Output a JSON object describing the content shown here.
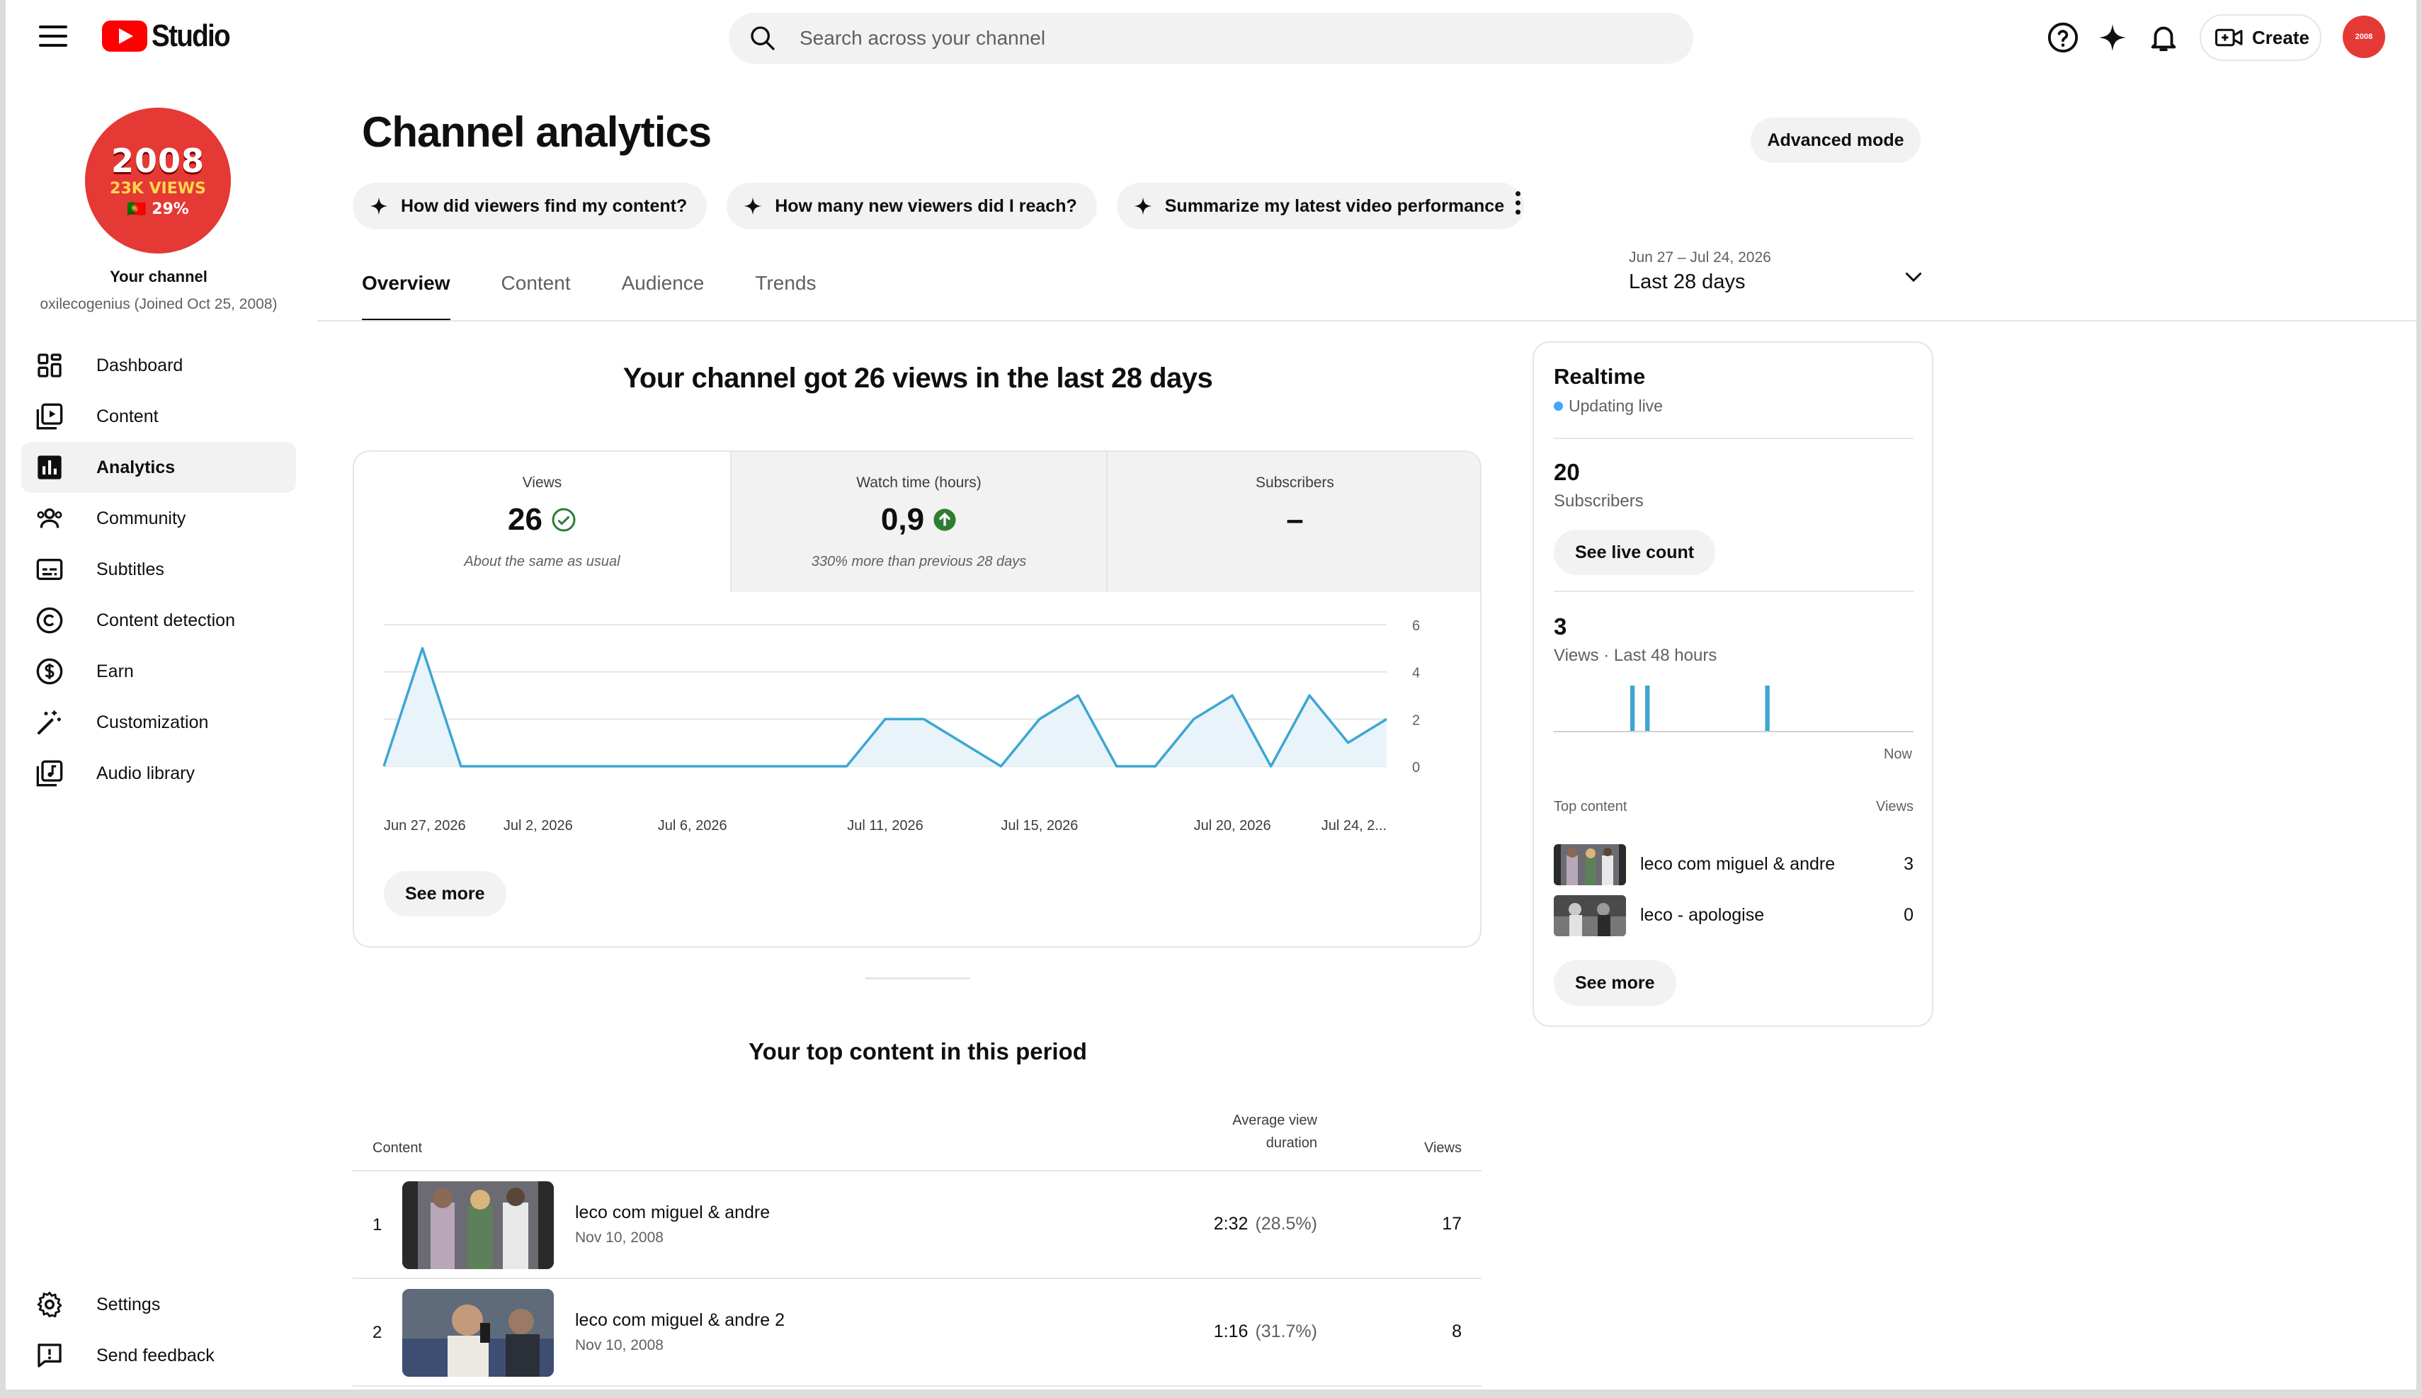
{
  "app": {
    "logo_text": "Studio",
    "brand_color": "#ff0000"
  },
  "search": {
    "placeholder": "Search across your channel"
  },
  "topbar": {
    "create_label": "Create",
    "avatar_text": "2008"
  },
  "channel": {
    "avatar_line1": "2008",
    "avatar_line2": "23K VIEWS",
    "avatar_line3": "🇵🇹 29%",
    "label": "Your channel",
    "handle": "oxilecogenius (Joined Oct 25, 2008)"
  },
  "sidebar": {
    "items": [
      {
        "label": "Dashboard",
        "icon": "dashboard-icon"
      },
      {
        "label": "Content",
        "icon": "content-icon"
      },
      {
        "label": "Analytics",
        "icon": "analytics-icon",
        "active": true
      },
      {
        "label": "Community",
        "icon": "community-icon"
      },
      {
        "label": "Subtitles",
        "icon": "subtitles-icon"
      },
      {
        "label": "Content detection",
        "icon": "copyright-icon"
      },
      {
        "label": "Earn",
        "icon": "dollar-icon"
      },
      {
        "label": "Customization",
        "icon": "magic-wand-icon"
      },
      {
        "label": "Audio library",
        "icon": "audio-library-icon"
      }
    ],
    "bottom": [
      {
        "label": "Settings",
        "icon": "gear-icon"
      },
      {
        "label": "Send feedback",
        "icon": "feedback-icon"
      }
    ]
  },
  "header": {
    "title": "Channel analytics",
    "advanced_mode": "Advanced mode",
    "chips": [
      "How did viewers find my content?",
      "How many new viewers did I reach?",
      "Summarize my latest video performance"
    ],
    "tabs": [
      "Overview",
      "Content",
      "Audience",
      "Trends"
    ],
    "date_range_sub": "Jun 27 – Jul 24, 2026",
    "date_range_main": "Last 28 days"
  },
  "overview": {
    "summary": "Your channel got 26 views in the last 28 days",
    "metrics": [
      {
        "label": "Views",
        "value": "26",
        "note": "About the same as usual"
      },
      {
        "label": "Watch time (hours)",
        "value": "0,9",
        "note": "330% more than previous 28 days"
      },
      {
        "label": "Subscribers",
        "value": "–",
        "note": ""
      }
    ],
    "see_more": "See more"
  },
  "chart_data": {
    "type": "area",
    "x_tick_labels": [
      "Jun 27, 2026",
      "Jul 2, 2026",
      "Jul 6, 2026",
      "Jul 11, 2026",
      "Jul 15, 2026",
      "Jul 20, 2026",
      "Jul 24, 2..."
    ],
    "x_tick_index": [
      0,
      4,
      8,
      13,
      17,
      22,
      26
    ],
    "values": [
      0,
      5,
      0,
      0,
      0,
      0,
      0,
      0,
      0,
      0,
      0,
      0,
      0,
      2,
      2,
      1,
      0,
      2,
      3,
      0,
      0,
      2,
      3,
      0,
      3,
      1,
      2
    ],
    "y_ticks": [
      0,
      2,
      4,
      6
    ],
    "ylim": [
      0,
      6
    ],
    "color": "#3ea6d2",
    "fill": "#e8f4fa",
    "grid": true
  },
  "top_content": {
    "title": "Your top content in this period",
    "col_content": "Content",
    "col_avd_line1": "Average view",
    "col_avd_line2": "duration",
    "col_views": "Views",
    "rows": [
      {
        "rank": "1",
        "title": "leco com miguel & andre",
        "date": "Nov 10, 2008",
        "avd": "2:32",
        "avd_pct": "(28.5%)",
        "views": "17"
      },
      {
        "rank": "2",
        "title": "leco com miguel & andre 2",
        "date": "Nov 10, 2008",
        "avd": "1:16",
        "avd_pct": "(31.7%)",
        "views": "8"
      }
    ]
  },
  "realtime": {
    "title": "Realtime",
    "live": "Updating live",
    "subscribers_value": "20",
    "subscribers_label": "Subscribers",
    "see_live_count": "See live count",
    "views_value": "3",
    "views_label": "Views · Last 48 hours",
    "bar_values": [
      0,
      0,
      0,
      0,
      0,
      0,
      0,
      0,
      0,
      0,
      1,
      0,
      1,
      0,
      0,
      0,
      0,
      0,
      0,
      0,
      0,
      0,
      0,
      0,
      0,
      0,
      0,
      0,
      1,
      0,
      0,
      0,
      0,
      0,
      0,
      0,
      0,
      0,
      0,
      0,
      0,
      0,
      0,
      0,
      0,
      0,
      0,
      0
    ],
    "now_label": "Now",
    "top_content_label": "Top content",
    "views_col": "Views",
    "items": [
      {
        "title": "leco com miguel & andre",
        "views": "3"
      },
      {
        "title": "leco - apologise",
        "views": "0"
      }
    ],
    "see_more": "See more"
  }
}
